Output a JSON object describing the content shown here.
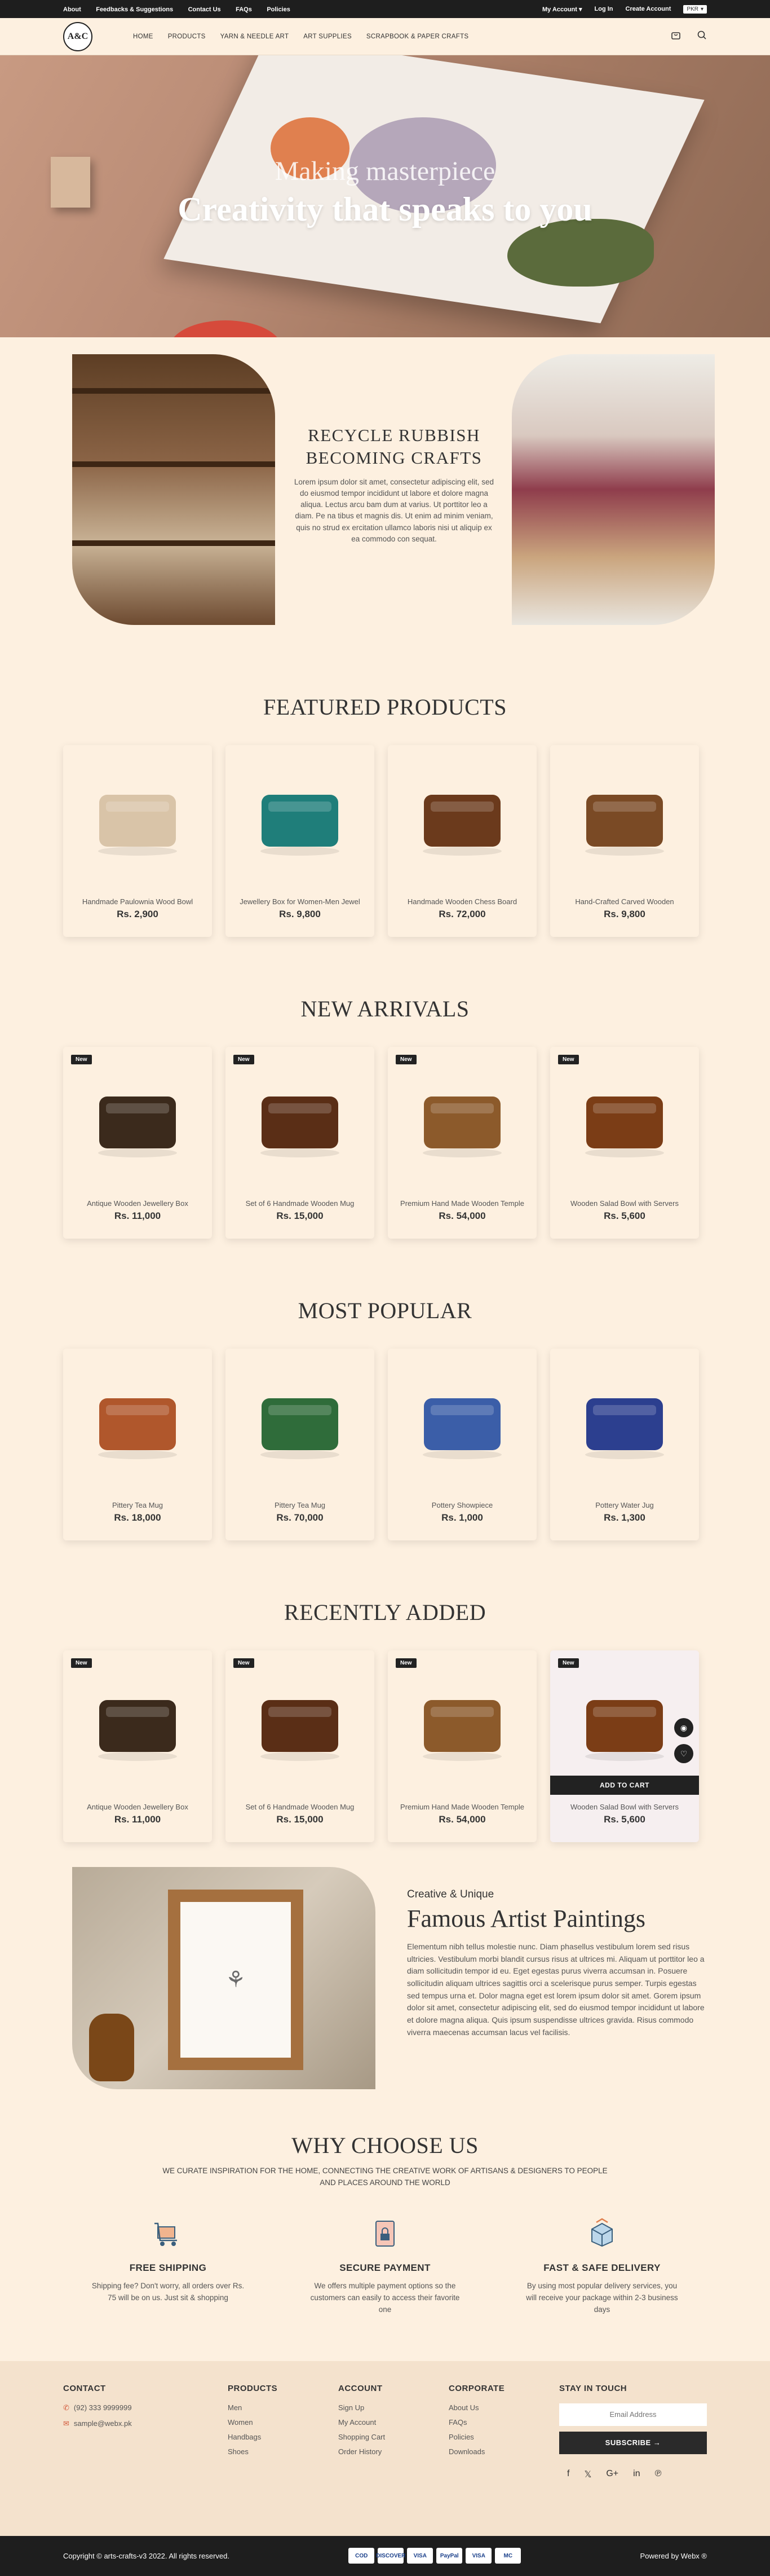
{
  "topbar": {
    "left_links": [
      "About",
      "Feedbacks & Suggestions",
      "Contact Us",
      "FAQs",
      "Policies"
    ],
    "my_account": "My Account",
    "login": "Log In",
    "create_account": "Create Account",
    "currency": "PKR"
  },
  "logo": {
    "text": "A&C"
  },
  "nav": {
    "items": [
      "HOME",
      "PRODUCTS",
      "YARN & NEEDLE ART",
      "ART SUPPLIES",
      "SCRAPBOOK & PAPER CRAFTS"
    ],
    "cart_icon": "bag-icon",
    "search_icon": "search-icon"
  },
  "hero": {
    "subtitle": "Making masterpiece",
    "title": "Creativity that speaks to you"
  },
  "recycle": {
    "title": "RECYCLE RUBBISH BECOMING CRAFTS",
    "body": "Lorem ipsum dolor sit amet, consectetur adipiscing elit, sed do eiusmod tempor incididunt ut labore et dolore magna aliqua. Lectus arcu bam dum at varius. Ut porttitor leo a diam. Pe na tibus et magnis dis. Ut enim ad minim veniam, quis no strud ex ercitation ullamco laboris nisi ut aliquip ex ea commodo con sequat."
  },
  "sections": [
    {
      "title": "FEATURED PRODUCTS",
      "products": [
        {
          "name": "Handmade Paulownia Wood Bowl",
          "price": "Rs. 2,900",
          "badge": ""
        },
        {
          "name": "Jewellery Box for Women-Men Jewel",
          "price": "Rs. 9,800",
          "badge": ""
        },
        {
          "name": "Handmade Wooden Chess Board",
          "price": "Rs. 72,000",
          "badge": ""
        },
        {
          "name": "Hand-Crafted Carved Wooden",
          "price": "Rs. 9,800",
          "badge": ""
        }
      ]
    },
    {
      "title": "NEW ARRIVALS",
      "products": [
        {
          "name": "Antique Wooden Jewellery Box",
          "price": "Rs. 11,000",
          "badge": "New"
        },
        {
          "name": "Set of 6 Handmade Wooden Mug",
          "price": "Rs. 15,000",
          "badge": "New"
        },
        {
          "name": "Premium Hand Made Wooden Temple",
          "price": "Rs. 54,000",
          "badge": "New"
        },
        {
          "name": "Wooden Salad Bowl with Servers",
          "price": "Rs. 5,600",
          "badge": "New"
        }
      ]
    },
    {
      "title": "MOST POPULAR",
      "products": [
        {
          "name": "Pittery Tea Mug",
          "price": "Rs. 18,000",
          "badge": ""
        },
        {
          "name": "Pittery Tea Mug",
          "price": "Rs. 70,000",
          "badge": ""
        },
        {
          "name": "Pottery Showpiece",
          "price": "Rs. 1,000",
          "badge": ""
        },
        {
          "name": "Pottery Water Jug",
          "price": "Rs. 1,300",
          "badge": ""
        }
      ]
    },
    {
      "title": "RECENTLY ADDED",
      "products": [
        {
          "name": "Antique Wooden Jewellery Box",
          "price": "Rs. 11,000",
          "badge": "New"
        },
        {
          "name": "Set of 6 Handmade Wooden Mug",
          "price": "Rs. 15,000",
          "badge": "New"
        },
        {
          "name": "Premium Hand Made Wooden Temple",
          "price": "Rs. 54,000",
          "badge": "New"
        },
        {
          "name": "Wooden Salad Bowl with Servers",
          "price": "Rs. 5,600",
          "badge": "New"
        }
      ]
    }
  ],
  "add_to_cart_label": "ADD TO CART",
  "artist": {
    "kicker": "Creative & Unique",
    "title": "Famous Artist Paintings",
    "body": "Elementum nibh tellus molestie nunc. Diam phasellus vestibulum lorem sed risus ultricies. Vestibulum morbi blandit cursus risus at ultrices mi. Aliquam ut porttitor leo a diam sollicitudin tempor id eu. Eget egestas purus viverra accumsan in. Posuere sollicitudin aliquam ultrices sagittis orci a scelerisque purus semper. Turpis egestas sed tempus urna et. Dolor magna eget est lorem ipsum dolor sit amet. Gorem ipsum dolor sit amet, consectetur adipiscing elit, sed do eiusmod tempor incididunt ut labore et dolore magna aliqua. Quis ipsum suspendisse ultrices gravida. Risus commodo viverra maecenas accumsan lacus vel facilisis."
  },
  "why": {
    "title": "WHY CHOOSE US",
    "subtitle": "WE CURATE INSPIRATION FOR THE HOME, CONNECTING THE CREATIVE WORK OF ARTISANS & DESIGNERS TO PEOPLE AND PLACES AROUND THE WORLD",
    "items": [
      {
        "title": "FREE SHIPPING",
        "text": "Shipping fee? Don't worry, all orders over Rs. 75 will be on us. Just sit & shopping",
        "icon": "shipping-cart-icon"
      },
      {
        "title": "SECURE PAYMENT",
        "text": "We offers multiple payment options so the customers can easily to access their favorite one",
        "icon": "secure-payment-icon"
      },
      {
        "title": "FAST & SAFE DELIVERY",
        "text": "By using most popular delivery services, you will receive your package within 2-3 business days",
        "icon": "delivery-box-icon"
      }
    ]
  },
  "footer": {
    "contact": {
      "title": "CONTACT",
      "phone": "(92) 333 9999999",
      "email": "sample@webx.pk"
    },
    "products": {
      "title": "PRODUCTS",
      "links": [
        "Men",
        "Women",
        "Handbags",
        "Shoes"
      ]
    },
    "account": {
      "title": "ACCOUNT",
      "links": [
        "Sign Up",
        "My Account",
        "Shopping Cart",
        "Order History"
      ]
    },
    "corporate": {
      "title": "CORPORATE",
      "links": [
        "About Us",
        "FAQs",
        "Policies",
        "Downloads"
      ]
    },
    "stay": {
      "title": "STAY IN TOUCH",
      "email_placeholder": "Email Address",
      "subscribe": "SUBSCRIBE →"
    },
    "social": [
      "f",
      "𝕏",
      "G+",
      "in",
      "℗"
    ]
  },
  "bottom": {
    "copyright": "Copyright © arts-crafts-v3 2022. All rights reserved.",
    "payments": [
      "COD",
      "DISCOVER",
      "VISA",
      "PayPal",
      "VISA",
      "MC"
    ],
    "powered": "Powered by Webx ®"
  }
}
